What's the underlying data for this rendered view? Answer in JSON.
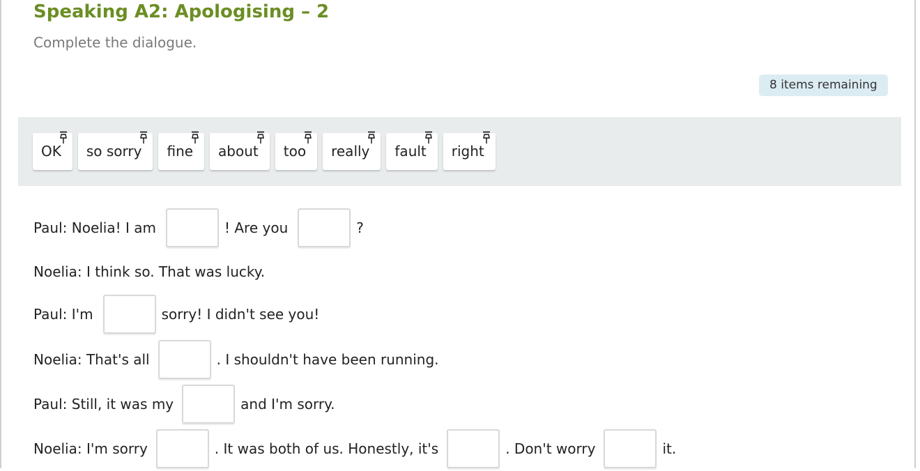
{
  "title": "Speaking A2: Apologising – 2",
  "subtitle": "Complete the dialogue.",
  "remaining": "8 items remaining",
  "words": [
    "OK",
    "so sorry",
    "fine",
    "about",
    "too",
    "really",
    "fault",
    "right"
  ],
  "dialogue": {
    "l1": {
      "a": "Paul: Noelia! I am",
      "b": "! Are you",
      "c": "?"
    },
    "l2": {
      "a": "Noelia: I think so. That was lucky."
    },
    "l3": {
      "a": "Paul: I'm",
      "b": "sorry! I didn't see you!"
    },
    "l4": {
      "a": "Noelia: That's all",
      "b": ". I shouldn't have been running."
    },
    "l5": {
      "a": "Paul: Still, it was my",
      "b": "and I'm sorry."
    },
    "l6": {
      "a": "Noelia: I'm sorry",
      "b": ". It was both of us. Honestly, it's",
      "c": ". Don't worry",
      "d": "it."
    }
  },
  "icons": {
    "chip": "pin-icon"
  },
  "colors": {
    "title": "#6b8e23",
    "badge": "#dcecf3",
    "bank": "#e9ecec"
  }
}
